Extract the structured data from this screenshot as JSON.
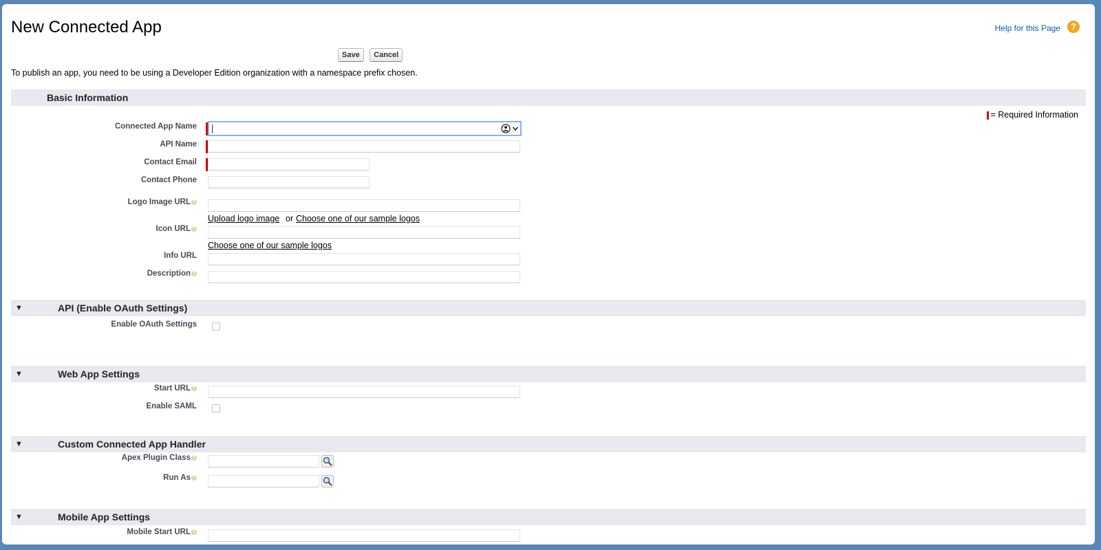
{
  "header": {
    "title": "New Connected App",
    "help_label": "Help for this Page",
    "help_icon": "?"
  },
  "buttons": {
    "save": "Save",
    "cancel": "Cancel"
  },
  "intro": "To publish an app, you need to be using a Developer Edition organization with a namespace prefix chosen.",
  "required_legend": "= Required Information",
  "sections": {
    "basic": {
      "title": "Basic Information"
    },
    "api": {
      "title": "API (Enable OAuth Settings)"
    },
    "web": {
      "title": "Web App Settings"
    },
    "handler": {
      "title": "Custom Connected App Handler"
    },
    "mobile": {
      "title": "Mobile App Settings"
    }
  },
  "fields": {
    "connected_app_name": {
      "label": "Connected App Name",
      "value": ""
    },
    "api_name": {
      "label": "API Name",
      "value": ""
    },
    "contact_email": {
      "label": "Contact Email",
      "value": ""
    },
    "contact_phone": {
      "label": "Contact Phone",
      "value": ""
    },
    "logo_image_url": {
      "label": "Logo Image URL",
      "value": ""
    },
    "icon_url": {
      "label": "Icon URL",
      "value": ""
    },
    "info_url": {
      "label": "Info URL",
      "value": ""
    },
    "description": {
      "label": "Description",
      "value": ""
    },
    "enable_oauth": {
      "label": "Enable OAuth Settings",
      "checked": false
    },
    "start_url": {
      "label": "Start URL",
      "value": ""
    },
    "enable_saml": {
      "label": "Enable SAML",
      "checked": false
    },
    "apex_plugin_class": {
      "label": "Apex Plugin Class",
      "value": ""
    },
    "run_as": {
      "label": "Run As",
      "value": ""
    },
    "mobile_start_url": {
      "label": "Mobile Start URL",
      "value": ""
    }
  },
  "links": {
    "upload_logo": "Upload logo image",
    "or": "or",
    "choose_logo": "Choose one of our sample logos",
    "choose_icon": "Choose one of our sample logos"
  },
  "colors": {
    "required": "#cc0000",
    "section_bg": "#e8e9ef",
    "link_blue": "#0f5fa8",
    "help_orange": "#f4a51e"
  },
  "icons": [
    "help-icon",
    "collapse-triangle-icon",
    "help-bubble-icon",
    "lookup-magnifier-icon",
    "contact-autofill-icon",
    "chevron-down-icon"
  ]
}
